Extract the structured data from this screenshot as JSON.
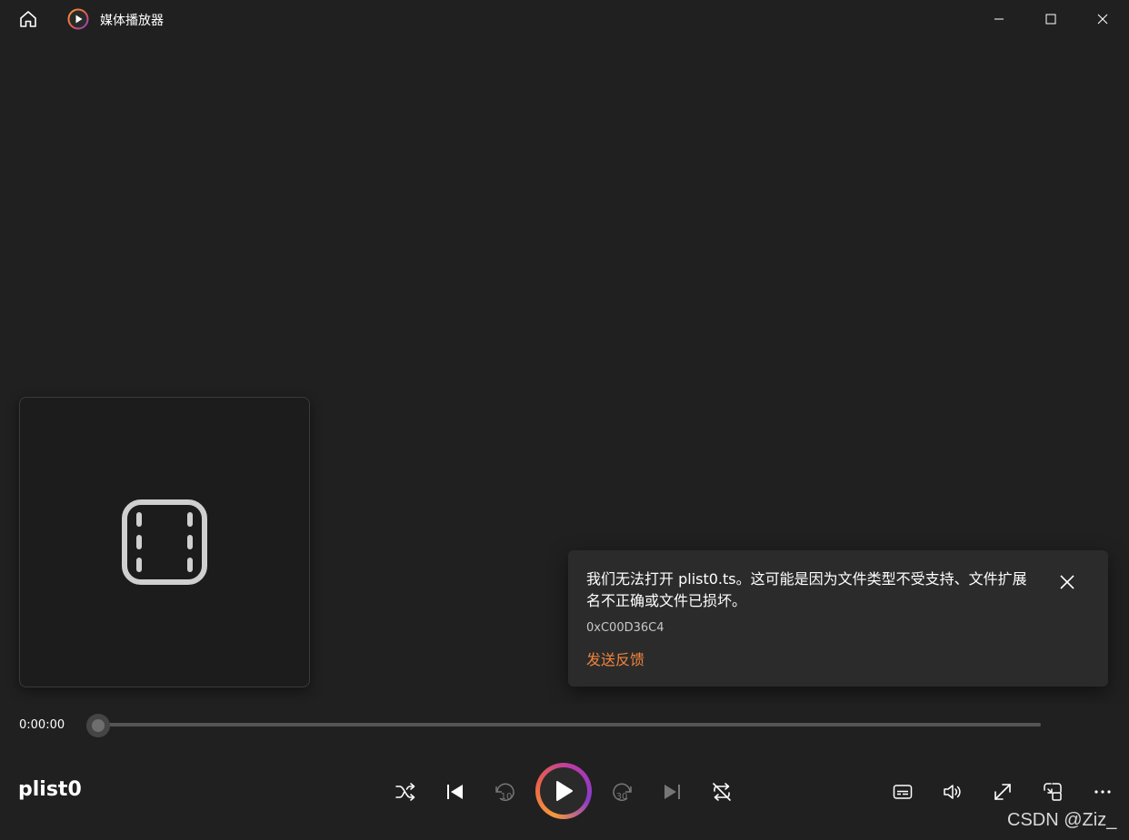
{
  "window": {
    "title": "媒体播放器"
  },
  "icons": {
    "home": "home-icon",
    "app_logo": "media-player-logo-icon",
    "minimize": "minimize-icon",
    "maximize": "maximize-icon",
    "close": "close-icon",
    "film": "film-icon",
    "toast_close": "close-icon",
    "shuffle": "shuffle-icon",
    "previous": "previous-icon",
    "rewind": "rewind-10-icon",
    "play": "play-icon",
    "forward": "forward-30-icon",
    "next": "next-icon",
    "repeat": "repeat-icon",
    "subtitles": "subtitles-icon",
    "volume": "volume-icon",
    "fullscreen": "fullscreen-icon",
    "miniplayer": "miniplayer-icon",
    "more": "more-icon"
  },
  "error": {
    "message": "我们无法打开 plist0.ts。这可能是因为文件类型不受支持、文件扩展名不正确或文件已损坏。",
    "code": "0xC00D36C4",
    "feedback_link": "发送反馈"
  },
  "player": {
    "current_time": "0:00:00",
    "progress": 0,
    "media_title": "plist0",
    "rewind_seconds": "10",
    "forward_seconds": "30"
  },
  "watermark": "CSDN @Ziz_",
  "colors": {
    "background": "#202020",
    "toast_background": "#2b2b2b",
    "link": "#f0843c",
    "accent_gradient_start": "#f59a3b",
    "accent_gradient_end": "#8a3bc9"
  }
}
